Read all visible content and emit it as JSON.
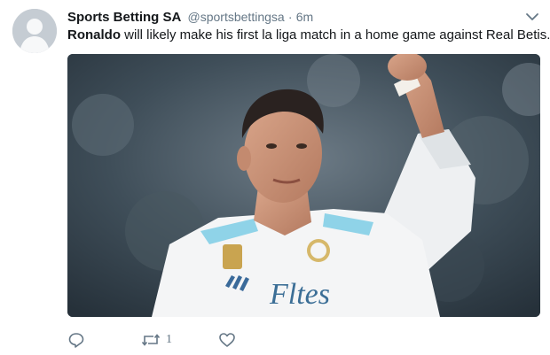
{
  "tweet": {
    "display_name": "Sports Betting SA",
    "handle": "@sportsbettingsa",
    "separator": "·",
    "time": "6m",
    "text_lead": "Ronaldo",
    "text_rest": " will likely make his first la liga match in a home game against  Real Betis.",
    "media": {
      "jersey_text": "Fltes"
    }
  },
  "actions": {
    "reply_icon": "reply-icon",
    "retweet_icon": "retweet-icon",
    "retweet_count": "1",
    "like_icon": "heart-icon"
  },
  "colors": {
    "text": "#14171a",
    "muted": "#657786",
    "avatar_bg": "#c5ccd3"
  }
}
